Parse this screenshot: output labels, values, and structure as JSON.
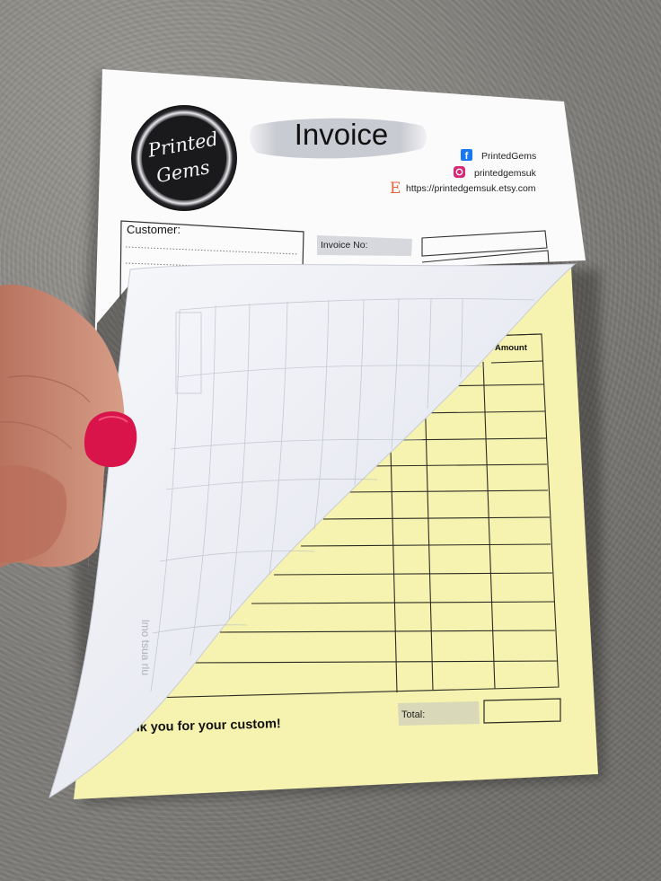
{
  "invoice": {
    "logo_line1": "Printed",
    "logo_line2": "Gems",
    "title": "Invoice",
    "facebook_handle": "PrintedGems",
    "instagram_handle": "printedgemsuk",
    "etsy_letter": "E",
    "etsy_url": "https://printedgemsuk.etsy.com",
    "customer_label": "Customer:",
    "invoice_no_label": "Invoice No:",
    "amount_header": "Amount",
    "total_label": "Total:",
    "thank_you_text": "hank you for your custom!",
    "ghost_text": "lmo tsua rlu"
  },
  "colors": {
    "yellow_sheet": "#f6f2b0",
    "white_sheet": "#fbfbfc",
    "curl_sheet": "#eef0f6",
    "nail_polish": "#d8144a",
    "skin": "#c98b76",
    "facebook_blue": "#1877f2",
    "instagram_pink": "#d62976",
    "etsy_orange": "#e3643a"
  }
}
